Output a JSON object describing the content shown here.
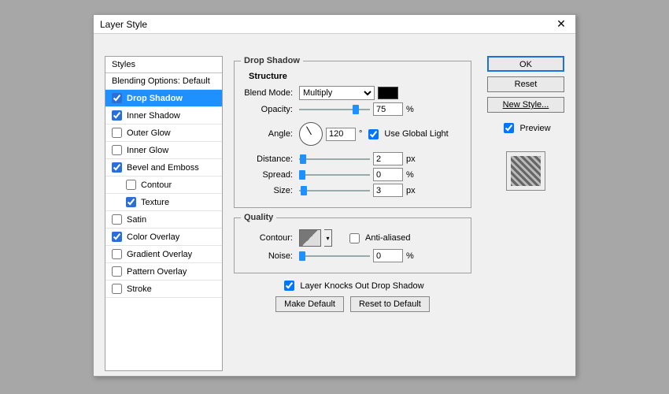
{
  "window": {
    "title": "Layer Style",
    "close": "✕"
  },
  "sidebar": {
    "header": "Styles",
    "blending": "Blending Options: Default",
    "items": [
      {
        "label": "Drop Shadow",
        "checked": true,
        "selected": true
      },
      {
        "label": "Inner Shadow",
        "checked": true
      },
      {
        "label": "Outer Glow",
        "checked": false
      },
      {
        "label": "Inner Glow",
        "checked": false
      },
      {
        "label": "Bevel and Emboss",
        "checked": true
      },
      {
        "label": "Contour",
        "checked": false,
        "indent": true
      },
      {
        "label": "Texture",
        "checked": true,
        "indent": true
      },
      {
        "label": "Satin",
        "checked": false
      },
      {
        "label": "Color Overlay",
        "checked": true
      },
      {
        "label": "Gradient Overlay",
        "checked": false
      },
      {
        "label": "Pattern Overlay",
        "checked": false
      },
      {
        "label": "Stroke",
        "checked": false
      }
    ]
  },
  "panel": {
    "title": "Drop Shadow",
    "structure": {
      "legend": "Structure",
      "blendModeLabel": "Blend Mode:",
      "blendMode": "Multiply",
      "opacityLabel": "Opacity:",
      "opacity": "75",
      "opacityUnit": "%",
      "angleLabel": "Angle:",
      "angle": "120",
      "angleUnit": "°",
      "useGlobalLabel": "Use Global Light",
      "useGlobal": true,
      "distanceLabel": "Distance:",
      "distance": "2",
      "distanceUnit": "px",
      "spreadLabel": "Spread:",
      "spread": "0",
      "spreadUnit": "%",
      "sizeLabel": "Size:",
      "size": "3",
      "sizeUnit": "px"
    },
    "quality": {
      "legend": "Quality",
      "contourLabel": "Contour:",
      "antiAliasedLabel": "Anti-aliased",
      "antiAliased": false,
      "noiseLabel": "Noise:",
      "noise": "0",
      "noiseUnit": "%"
    },
    "knockOutLabel": "Layer Knocks Out Drop Shadow",
    "knockOut": true,
    "makeDefault": "Make Default",
    "resetDefault": "Reset to Default"
  },
  "buttons": {
    "ok": "OK",
    "reset": "Reset",
    "newStyle": "New Style...",
    "previewLabel": "Preview",
    "preview": true
  }
}
